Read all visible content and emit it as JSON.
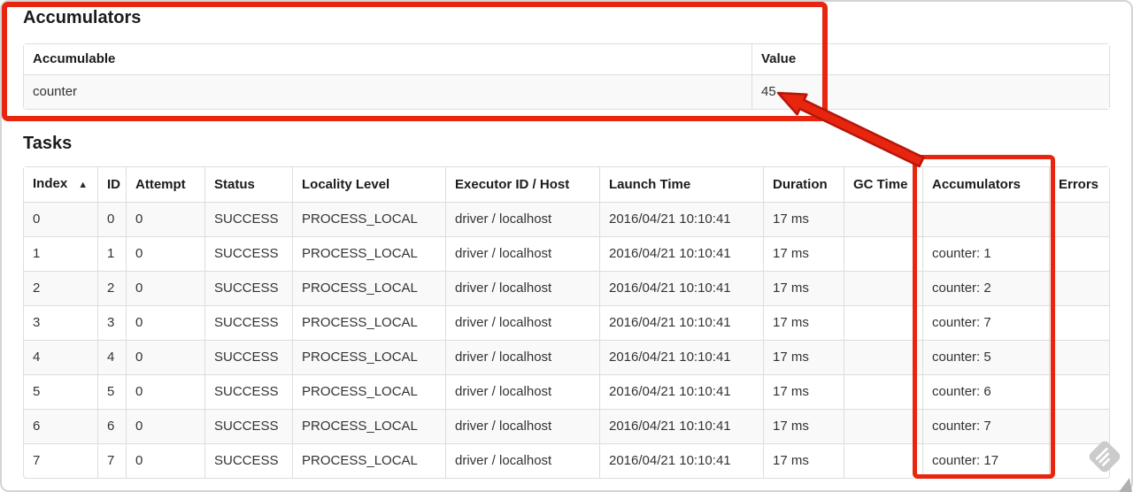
{
  "colors": {
    "annotation_red": "#e8250e",
    "annotation_red_outline": "#b5160a",
    "table_border": "#dddddd",
    "row_stripe": "#f9f9f9",
    "watermark_gray": "#cbcbcb"
  },
  "accumulators_section": {
    "title": "Accumulators",
    "headers": [
      "Accumulable",
      "Value"
    ],
    "rows": [
      [
        "counter",
        "45"
      ]
    ]
  },
  "tasks_section": {
    "title": "Tasks",
    "sort_icon": "▲",
    "headers": [
      "Index",
      "ID",
      "Attempt",
      "Status",
      "Locality Level",
      "Executor ID / Host",
      "Launch Time",
      "Duration",
      "GC Time",
      "Accumulators",
      "Errors"
    ],
    "rows": [
      [
        "0",
        "0",
        "0",
        "SUCCESS",
        "PROCESS_LOCAL",
        "driver / localhost",
        "2016/04/21 10:10:41",
        "17 ms",
        "",
        "",
        ""
      ],
      [
        "1",
        "1",
        "0",
        "SUCCESS",
        "PROCESS_LOCAL",
        "driver / localhost",
        "2016/04/21 10:10:41",
        "17 ms",
        "",
        "counter: 1",
        ""
      ],
      [
        "2",
        "2",
        "0",
        "SUCCESS",
        "PROCESS_LOCAL",
        "driver / localhost",
        "2016/04/21 10:10:41",
        "17 ms",
        "",
        "counter: 2",
        ""
      ],
      [
        "3",
        "3",
        "0",
        "SUCCESS",
        "PROCESS_LOCAL",
        "driver / localhost",
        "2016/04/21 10:10:41",
        "17 ms",
        "",
        "counter: 7",
        ""
      ],
      [
        "4",
        "4",
        "0",
        "SUCCESS",
        "PROCESS_LOCAL",
        "driver / localhost",
        "2016/04/21 10:10:41",
        "17 ms",
        "",
        "counter: 5",
        ""
      ],
      [
        "5",
        "5",
        "0",
        "SUCCESS",
        "PROCESS_LOCAL",
        "driver / localhost",
        "2016/04/21 10:10:41",
        "17 ms",
        "",
        "counter: 6",
        ""
      ],
      [
        "6",
        "6",
        "0",
        "SUCCESS",
        "PROCESS_LOCAL",
        "driver / localhost",
        "2016/04/21 10:10:41",
        "17 ms",
        "",
        "counter: 7",
        ""
      ],
      [
        "7",
        "7",
        "0",
        "SUCCESS",
        "PROCESS_LOCAL",
        "driver / localhost",
        "2016/04/21 10:10:41",
        "17 ms",
        "",
        "counter: 17",
        ""
      ]
    ]
  }
}
